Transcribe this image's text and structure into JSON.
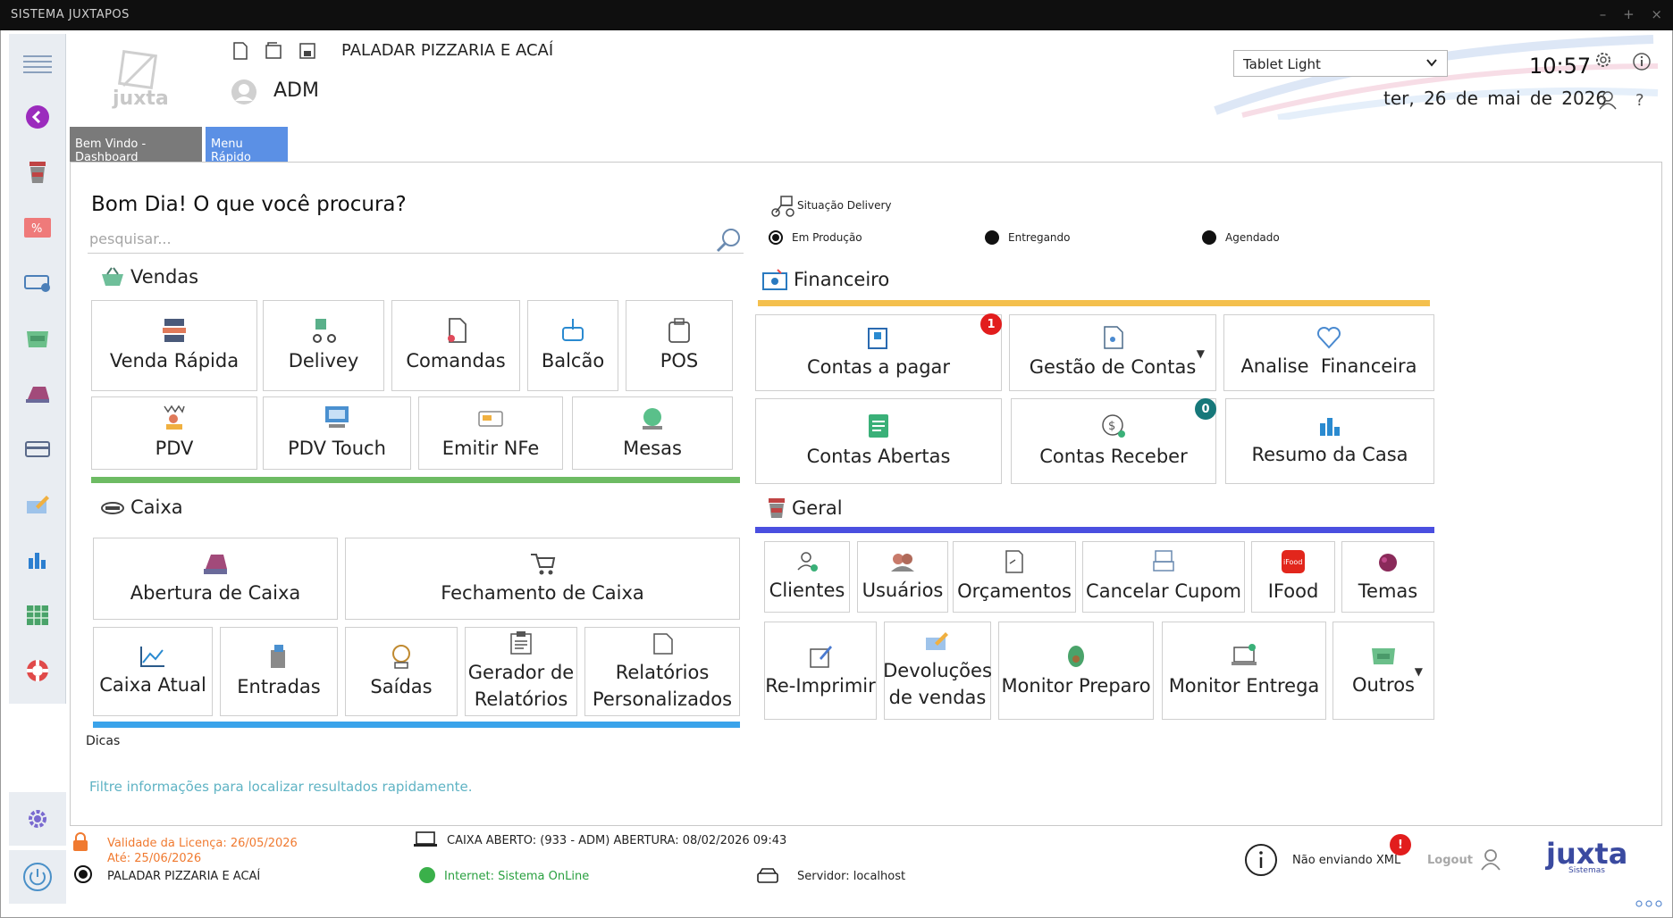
{
  "window": {
    "title": "SISTEMA JUXTAPOS",
    "controls": [
      "–",
      "+",
      "×"
    ]
  },
  "header": {
    "logo_text": "juxta",
    "company": "PALADAR PIZZARIA E ACAÍ",
    "user": "ADM",
    "theme": "Tablet Light",
    "time": "10:57",
    "date": "ter, 26 de mai de 2026",
    "help": "?"
  },
  "tabs": [
    {
      "label": "Bem Vindo - Dashboard",
      "active": false
    },
    {
      "label": "Menu Rápido",
      "active": true
    }
  ],
  "greeting": "Bom Dia! O que você procura?",
  "search": {
    "placeholder": "pesquisar..."
  },
  "vendas": {
    "title": "Vendas",
    "row1": [
      "Venda Rápida",
      "Delivey",
      "Comandas",
      "Balcão",
      "POS"
    ],
    "row2": [
      "PDV",
      "PDV Touch",
      "Emitir NFe",
      "Mesas"
    ],
    "color": "#6dbb63"
  },
  "caixa": {
    "title": "Caixa",
    "row1": [
      "Abertura de Caixa",
      "Fechamento de Caixa"
    ],
    "row2": [
      "Caixa Atual",
      "Entradas",
      "Saídas"
    ],
    "gerador": [
      "Gerador de",
      "Relatórios"
    ],
    "relatorios": [
      "Relatórios",
      "Personalizados"
    ],
    "color": "#3aa3ea"
  },
  "delivery": {
    "title": "Situação Delivery",
    "statuses": [
      "Em Produção",
      "Entregando",
      "Agendado"
    ]
  },
  "financeiro": {
    "title": "Financeiro",
    "row1": [
      "Contas a pagar",
      "Gestão de Contas",
      "Analise  Financeira"
    ],
    "row2": [
      "Contas Abertas",
      "Contas Receber",
      "Resumo da Casa"
    ],
    "badge_pagar": "1",
    "badge_receber": "0",
    "color": "#f4c04e"
  },
  "geral": {
    "title": "Geral",
    "row1": [
      "Clientes",
      "Usuários",
      "Orçamentos",
      "Cancelar Cupom",
      "IFood",
      "Temas"
    ],
    "row2": [
      "Re-Imprimir",
      "Monitor Preparo",
      "Monitor Entrega",
      "Outros"
    ],
    "devolucoes": [
      "Devoluções",
      "de vendas"
    ],
    "ifood_logo": "iFood",
    "color": "#4a4fe0"
  },
  "dicas": {
    "title": "Dicas",
    "text": "Filtre informações para localizar resultados rapidamente."
  },
  "footer": {
    "license_valid": "Validade da Licença: 26/05/2026",
    "license_until": "Até: 25/06/2026",
    "company": "PALADAR PIZZARIA E ACAÍ",
    "caixa": "CAIXA ABERTO: (933 - ADM) ABERTURA: 08/02/2026 09:43",
    "internet": "Internet: Sistema OnLine",
    "servidor": "Servidor: localhost",
    "xml": "Não enviando XML",
    "xml_badge": "!",
    "logout": "Logout",
    "brand": "juxta",
    "brand_sub": "Sistemas"
  }
}
